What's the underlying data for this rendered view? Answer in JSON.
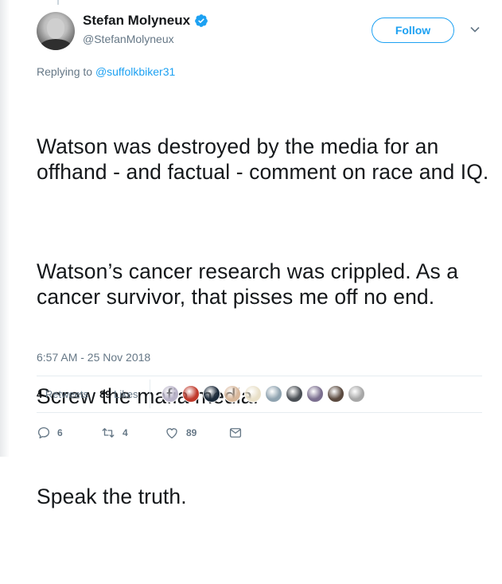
{
  "author": {
    "display_name": "Stefan Molyneux",
    "screen_name": "@StefanMolyneux"
  },
  "follow_label": "Follow",
  "reply_context": {
    "prefix": "Replying to ",
    "handle": "@suffolkbiker31"
  },
  "tweet": {
    "paragraphs": [
      "Watson was destroyed by the media for an offhand - and factual - comment on race and IQ.",
      "Watson’s cancer research was crippled. As a cancer survivor, that pisses me off no end.",
      "Screw the mafia media.",
      "Speak the truth."
    ],
    "timestamp": "6:57 AM - 25 Nov 2018"
  },
  "stats": {
    "retweets_count": "4",
    "retweets_label": "Retweets",
    "likes_count": "89",
    "likes_label": "Likes"
  },
  "likers": [
    {
      "icon": "liker-avatar",
      "color": "#b9b3c9"
    },
    {
      "icon": "liker-avatar",
      "color": "#c0392b"
    },
    {
      "icon": "liker-avatar",
      "color": "#1b2a3a"
    },
    {
      "icon": "liker-avatar",
      "color": "#d8b79a"
    },
    {
      "icon": "liker-avatar",
      "color": "#e9e0c8"
    },
    {
      "icon": "liker-avatar",
      "color": "#8fa3b0"
    },
    {
      "icon": "liker-avatar",
      "color": "#4a4f55"
    },
    {
      "icon": "liker-avatar",
      "color": "#7b6f8f"
    },
    {
      "icon": "liker-avatar",
      "color": "#5b4a3f"
    },
    {
      "icon": "liker-avatar",
      "color": "#a7a7a7"
    }
  ],
  "actions": {
    "reply_count": "6",
    "retweet_count": "4",
    "like_count": "89"
  },
  "colors": {
    "accent": "#1da1f2",
    "verified": "#1da1f2",
    "secondary_text": "#657786",
    "divider": "#e6ecf0"
  }
}
